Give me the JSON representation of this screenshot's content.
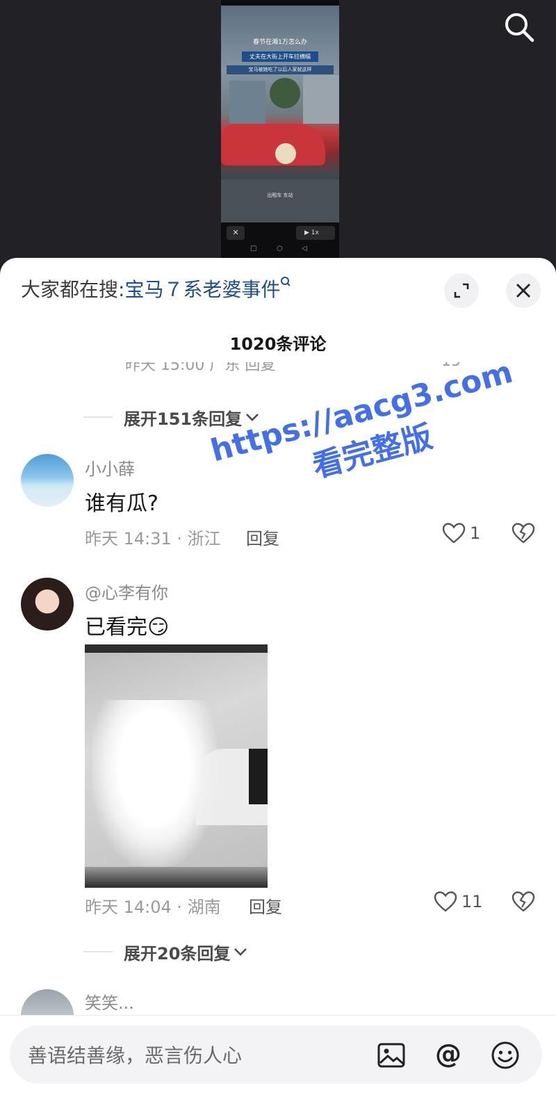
{
  "video": {
    "title_line1": "春节在湘1万怎么办",
    "title_line2": "丈夫在大街上开车拉横幅",
    "title_line3": "宝马被她吃了以后人家就这样",
    "caption": "出租车 东站",
    "speed": "1x"
  },
  "hot_search": {
    "prefix": "大家都在搜:",
    "term": "宝马７系老婆事件",
    "q_icon": "search-icon"
  },
  "comments_header": {
    "title": "1020条评论"
  },
  "ghost_row": {
    "text": "昨天 15:00 广东   回复",
    "likes": "15"
  },
  "expand1": {
    "label": "展开151条回复"
  },
  "comments": [
    {
      "name": "小小薛",
      "text": "谁有瓜?",
      "meta": "昨天 14:31 · 浙江",
      "reply": "回复",
      "likes": "1"
    },
    {
      "name": "@心李有你",
      "text": "已看完😏",
      "meta": "昨天 14:04 · 湖南",
      "reply": "回复",
      "likes": "11"
    },
    {
      "name": "笑笑..."
    }
  ],
  "expand2": {
    "label": "展开20条回复"
  },
  "watermark": {
    "line1": "https://aacg3.com",
    "line2": "看完整版"
  },
  "input": {
    "placeholder": "善语结善缘，恶言伤人心"
  },
  "colors": {
    "accent": "#1e4f8a",
    "watermark": "#3563e6",
    "text": "#161616",
    "meta": "#9a9a9a"
  }
}
